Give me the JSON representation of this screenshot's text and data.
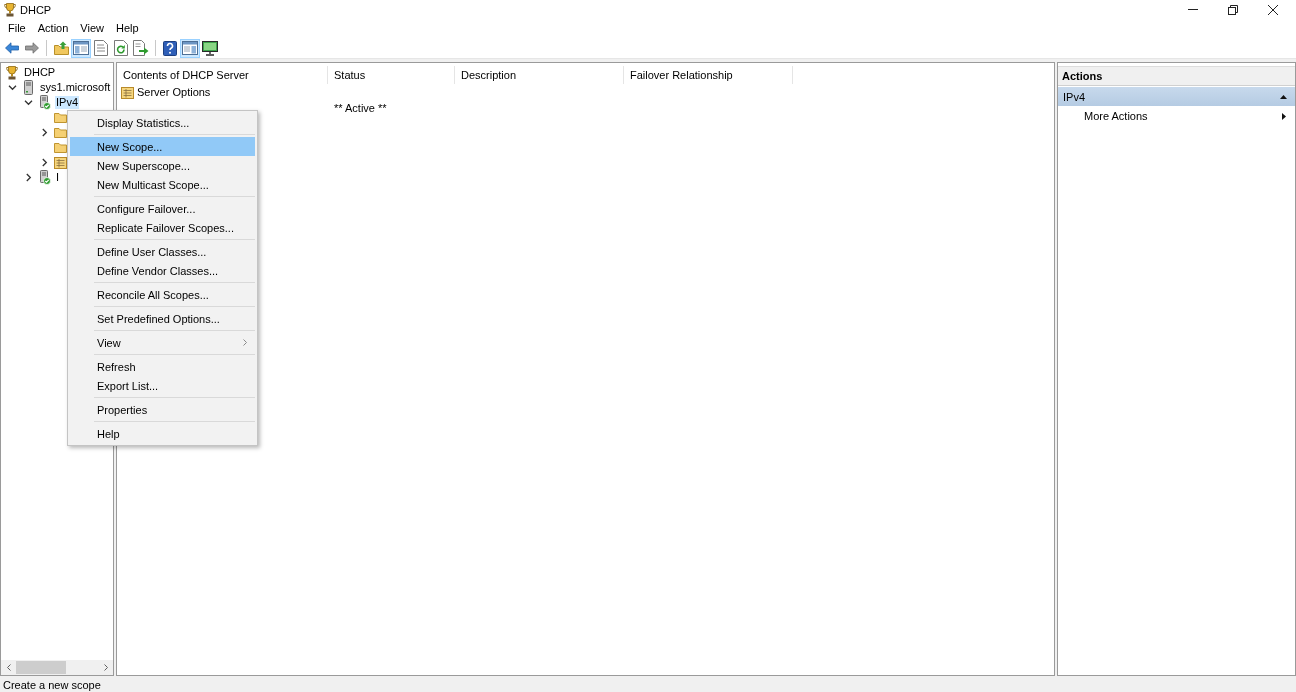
{
  "window": {
    "title": "DHCP"
  },
  "menu_bar": [
    "File",
    "Action",
    "View",
    "Help"
  ],
  "toolbar": {
    "groups": [
      [
        {
          "kind": "back",
          "pressed": false,
          "disabled": false
        },
        {
          "kind": "forward",
          "pressed": false,
          "disabled": true
        }
      ],
      [
        {
          "kind": "up",
          "pressed": false,
          "disabled": false
        },
        {
          "kind": "console_tree",
          "pressed": true,
          "disabled": false
        },
        {
          "kind": "properties",
          "pressed": false,
          "disabled": false
        },
        {
          "kind": "refresh",
          "pressed": false,
          "disabled": false
        },
        {
          "kind": "export",
          "pressed": false,
          "disabled": false
        }
      ],
      [
        {
          "kind": "help",
          "pressed": false,
          "disabled": false
        },
        {
          "kind": "action_pane",
          "pressed": true,
          "disabled": false
        },
        {
          "kind": "monitor",
          "pressed": false,
          "disabled": false
        }
      ]
    ]
  },
  "tree": {
    "items": [
      {
        "label": "DHCP",
        "kind": "root",
        "expandable": false,
        "expanded": true,
        "selected": false,
        "children": [
          {
            "label": "sys1.microsoft",
            "kind": "server",
            "expandable": true,
            "expanded": true,
            "selected": false,
            "children": [
              {
                "label": "IPv4",
                "kind": "protocol",
                "expandable": true,
                "expanded": true,
                "selected": true,
                "children": [
                  {
                    "kind": "folder",
                    "expandable": false,
                    "expanded": false,
                    "selected": false
                  },
                  {
                    "kind": "folder",
                    "expandable": true,
                    "expanded": false,
                    "selected": false
                  },
                  {
                    "kind": "folder",
                    "expandable": false,
                    "expanded": false,
                    "selected": false
                  },
                  {
                    "kind": "options",
                    "expandable": true,
                    "expanded": false,
                    "selected": false
                  }
                ]
              },
              {
                "label": "I",
                "kind": "protocol",
                "expandable": true,
                "expanded": false,
                "selected": false
              }
            ]
          }
        ]
      }
    ]
  },
  "content": {
    "columns": [
      "Contents of DHCP Server",
      "Status",
      "Description",
      "Failover Relationship"
    ],
    "rows": [
      {
        "name": "Server Options"
      },
      {
        "status": "** Active **"
      }
    ]
  },
  "context_menu": {
    "groups": [
      [
        {
          "label": "Display Statistics...",
          "selected": false,
          "submenu": false
        }
      ],
      [
        {
          "label": "New Scope...",
          "selected": true,
          "submenu": false
        },
        {
          "label": "New Superscope...",
          "selected": false,
          "submenu": false
        },
        {
          "label": "New Multicast Scope...",
          "selected": false,
          "submenu": false
        }
      ],
      [
        {
          "label": "Configure Failover...",
          "selected": false,
          "submenu": false
        },
        {
          "label": "Replicate Failover Scopes...",
          "selected": false,
          "submenu": false
        }
      ],
      [
        {
          "label": "Define User Classes...",
          "selected": false,
          "submenu": false
        },
        {
          "label": "Define Vendor Classes...",
          "selected": false,
          "submenu": false
        }
      ],
      [
        {
          "label": "Reconcile All Scopes...",
          "selected": false,
          "submenu": false
        }
      ],
      [
        {
          "label": "Set Predefined Options...",
          "selected": false,
          "submenu": false
        }
      ],
      [
        {
          "label": "View",
          "selected": false,
          "submenu": true
        }
      ],
      [
        {
          "label": "Refresh",
          "selected": false,
          "submenu": false
        },
        {
          "label": "Export List...",
          "selected": false,
          "submenu": false
        }
      ],
      [
        {
          "label": "Properties",
          "selected": false,
          "submenu": false
        }
      ],
      [
        {
          "label": "Help",
          "selected": false,
          "submenu": false
        }
      ]
    ]
  },
  "actions_pane": {
    "title": "Actions",
    "sections": [
      {
        "label": "IPv4",
        "expanded": true,
        "items": [
          {
            "label": "More Actions",
            "submenu": true
          }
        ]
      }
    ]
  },
  "status_bar": {
    "text": "Create a new scope"
  }
}
